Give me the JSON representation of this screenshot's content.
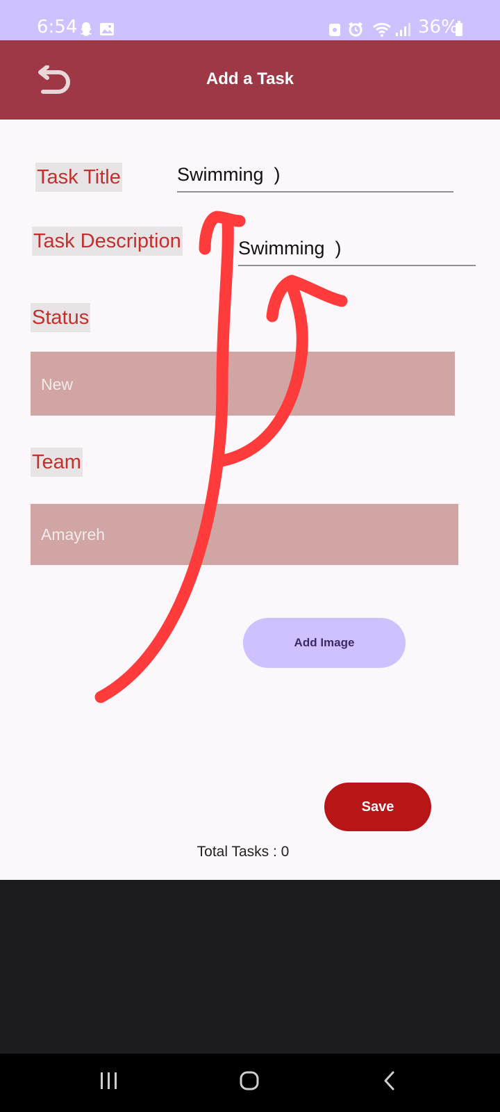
{
  "status_bar": {
    "time": "6:54",
    "battery": "36%"
  },
  "toolbar": {
    "title": "Add a Task"
  },
  "form": {
    "task_title_label": "Task Title",
    "task_title_value": "Swimming  )",
    "task_description_label": "Task Description",
    "task_description_value": "Swimming  )",
    "status_label": "Status",
    "status_value": "New",
    "team_label": "Team",
    "team_value": "Amayreh"
  },
  "buttons": {
    "add_image": "Add Image",
    "save": "Save"
  },
  "footer": {
    "total_tasks": "Total Tasks : 0"
  },
  "colors": {
    "status_bar": "#cfc0ff",
    "toolbar": "#9e3846",
    "label_text": "#c0302e",
    "spinner_bg": "#d0a5a4",
    "save_button": "#b81517",
    "add_image_button": "#cfc0ff",
    "annotation_stroke": "#ff3b3b"
  }
}
